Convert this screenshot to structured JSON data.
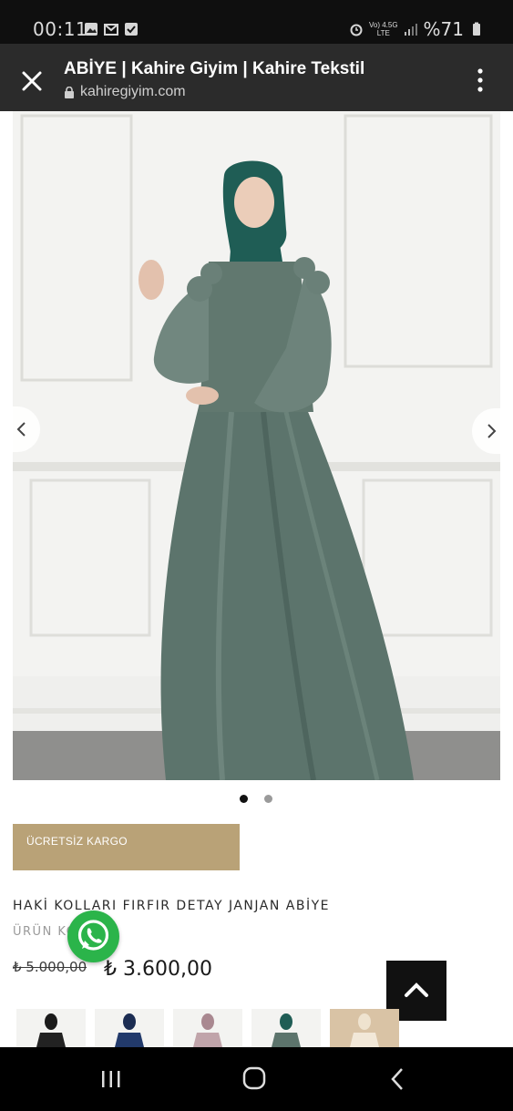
{
  "status_bar": {
    "time": "00:11",
    "net_top": "Vo) 4.5G",
    "net_bottom": "LTE",
    "battery": "%71",
    "left_icons": [
      "image-icon",
      "gmail-icon",
      "check-notification-icon"
    ],
    "right_icons": [
      "alarm-icon",
      "signal-icon",
      "battery-icon"
    ]
  },
  "toolbar": {
    "title": "ABİYE | Kahire Giyim | Kahire Tekstil",
    "url": "kahiregiyim.com"
  },
  "carousel": {
    "dots": [
      "1",
      "2"
    ],
    "active_index": 0
  },
  "product": {
    "badge": "ÜCRETSİZ KARGO",
    "name": "HAKİ KOLLARI FIRFIR DETAY JANJAN ABİYE",
    "code_label": "ÜRÜN KODU",
    "old_price": "₺ 5.000,00",
    "new_price": "₺ 3.600,00"
  },
  "colors": {
    "dress": "#5c746c",
    "hijab": "#1f5d55",
    "badge_bg": "#b9a277",
    "whatsapp": "#2bb44a",
    "toolbar_bg": "#2b2b2b"
  },
  "thumbnails": [
    "black",
    "navy",
    "mauve",
    "green",
    "cream"
  ]
}
